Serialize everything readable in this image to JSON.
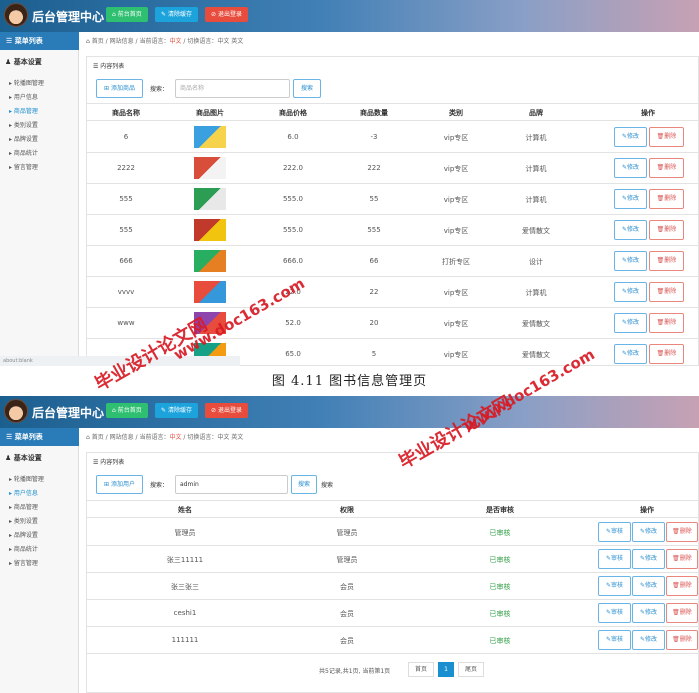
{
  "header": {
    "brand": "后台管理中心",
    "buttons": [
      "前台首页",
      "清除缓存",
      "退出登录"
    ],
    "colors": {
      "green": "#2fbf71",
      "blue": "#1ca3dc",
      "red": "#e74c3c"
    }
  },
  "sidebar": {
    "title": "菜单列表",
    "section": "基本设置",
    "items": [
      "轮播图管理",
      "用户信息",
      "商品管理",
      "类别设置",
      "品牌设置",
      "商品统计",
      "留言管理"
    ]
  },
  "breadcrumb": {
    "home": "首页",
    "site_info": "网站信息",
    "current_lang_label": "当前语言：",
    "current_lang": "中文",
    "switch_label": "切换语言：",
    "lang_zh": "中文",
    "lang_en": "英文"
  },
  "shot1": {
    "panel_title": "内容列表",
    "add_button": "添加商品",
    "search_label": "搜索：",
    "search_placeholder": "商品名称",
    "search_button": "搜索",
    "headers": [
      "商品名称",
      "商品图片",
      "商品价格",
      "商品数量",
      "类别",
      "品牌",
      "操作"
    ],
    "rows": [
      {
        "name": "6",
        "price": "6.0",
        "qty": "-3",
        "cat": "vip专区",
        "brand": "计算机"
      },
      {
        "name": "2222",
        "price": "222.0",
        "qty": "222",
        "cat": "vip专区",
        "brand": "计算机"
      },
      {
        "name": "555",
        "price": "555.0",
        "qty": "55",
        "cat": "vip专区",
        "brand": "计算机"
      },
      {
        "name": "555",
        "price": "555.0",
        "qty": "555",
        "cat": "vip专区",
        "brand": "爱情散文"
      },
      {
        "name": "666",
        "price": "666.0",
        "qty": "66",
        "cat": "打折专区",
        "brand": "设计"
      },
      {
        "name": "vvvv",
        "price": "22.0",
        "qty": "22",
        "cat": "vip专区",
        "brand": "计算机"
      },
      {
        "name": "www",
        "price": "52.0",
        "qty": "20",
        "cat": "vip专区",
        "brand": "爱情散文"
      },
      {
        "name": "",
        "price": "65.0",
        "qty": "5",
        "cat": "vip专区",
        "brand": "爱情散文"
      }
    ],
    "edit": "修改",
    "delete": "删除",
    "status": "about:blank"
  },
  "caption": "图 4.11  图书信息管理页",
  "shot2": {
    "panel_title": "内容列表",
    "add_button": "添加用户",
    "search_label": "搜索：",
    "search_value": "admin",
    "search_button": "搜索",
    "search_after": "搜索",
    "headers": [
      "姓名",
      "权限",
      "是否审核",
      "操作"
    ],
    "rows": [
      {
        "name": "管理员",
        "role": "管理员",
        "audit": "已审核"
      },
      {
        "name": "张三11111",
        "role": "管理员",
        "audit": "已审核"
      },
      {
        "name": "张三张三",
        "role": "会员",
        "audit": "已审核"
      },
      {
        "name": "ceshi1",
        "role": "会员",
        "audit": "已审核"
      },
      {
        "name": "111111",
        "role": "会员",
        "audit": "已审核"
      }
    ],
    "review": "审核",
    "edit": "修改",
    "delete": "删除",
    "pager_text": "共5记录,共1页, 当前第1页",
    "first": "首页",
    "page": "1",
    "last": "尾页"
  },
  "watermarks": {
    "cn": "毕业设计论文网",
    "url": "www.doc163.com"
  }
}
